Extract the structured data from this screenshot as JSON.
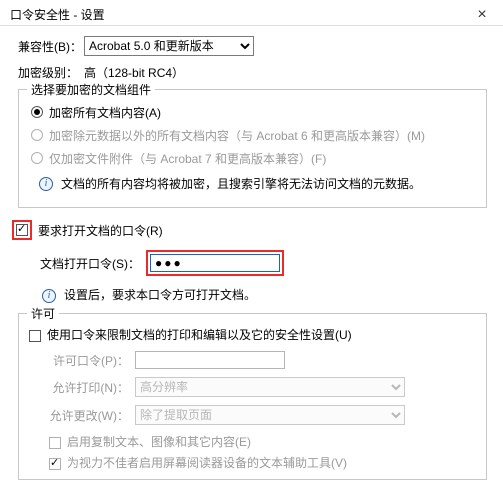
{
  "window": {
    "title": "口令安全性 - 设置"
  },
  "compat": {
    "label": "兼容性(B)：",
    "value": "Acrobat 5.0 和更新版本"
  },
  "encryption_level": {
    "label": "加密级别：",
    "value": "高（128-bit RC4）"
  },
  "encrypt_group": {
    "legend": "选择要加密的文档组件",
    "opt_all": "加密所有文档内容(A)",
    "opt_except_meta": "加密除元数据以外的所有文档内容（与 Acrobat 6 和更高版本兼容）(M)",
    "opt_attachments": "仅加密文件附件（与 Acrobat 7 和更高版本兼容）(F)",
    "note": "文档的所有内容均将被加密，且搜索引擎将无法访问文档的元数据。"
  },
  "open_pwd": {
    "checkbox_label": "要求打开文档的口令(R)",
    "field_label": "文档打开口令(S)：",
    "field_value": "●●●",
    "note": "设置后，要求本口令方可打开文档。"
  },
  "perm_group": {
    "legend": "许可",
    "restrict_label": "使用口令来限制文档的打印和编辑以及它的安全性设置(U)",
    "perm_pwd_label": "许可口令(P)：",
    "allow_print_label": "允许打印(N)：",
    "allow_print_value": "高分辨率",
    "allow_change_label": "允许更改(W)：",
    "allow_change_value": "除了提取页面",
    "enable_copy_label": "启用复制文本、图像和其它内容(E)",
    "enable_reader_label": "为视力不佳者启用屏幕阅读器设备的文本辅助工具(V)"
  }
}
